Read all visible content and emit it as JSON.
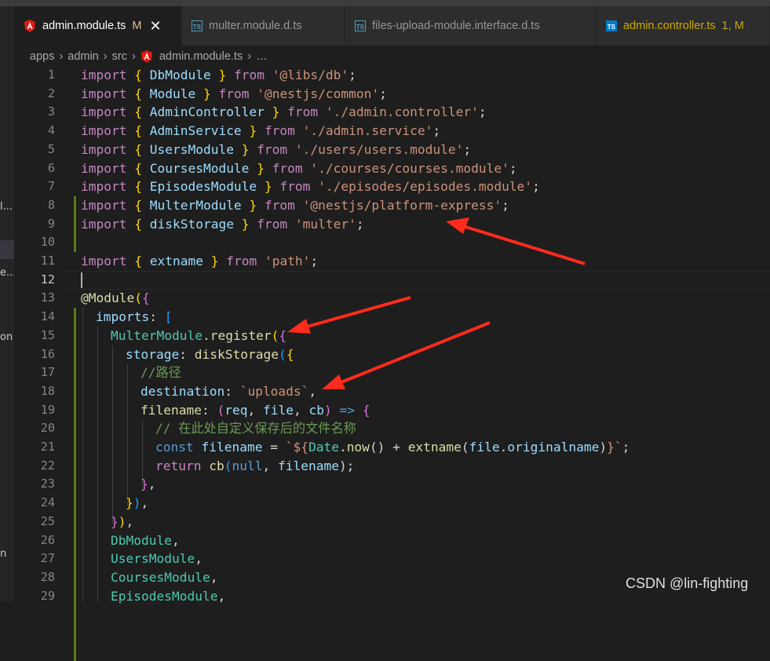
{
  "tabs": [
    {
      "label": "admin.module.ts",
      "modified": "M",
      "close": "✕",
      "icon": "angular-icon",
      "active": true
    },
    {
      "label": "multer.module.d.ts",
      "icon": "ts-icon"
    },
    {
      "label": "files-upload-module.interface.d.ts",
      "icon": "ts-icon"
    },
    {
      "label": "admin.controller.ts",
      "modified": "1, M",
      "icon": "ts-icon",
      "warn": true
    }
  ],
  "ts_icon_text": "TS",
  "breadcrumb": [
    "apps",
    "admin",
    "src",
    "admin.module.ts",
    "…"
  ],
  "activity_fragments": [
    "l...",
    "e...",
    "on",
    "n"
  ],
  "line_numbers": [
    "1",
    "2",
    "3",
    "4",
    "5",
    "6",
    "7",
    "8",
    "9",
    "10",
    "11",
    "12",
    "13",
    "14",
    "15",
    "16",
    "17",
    "18",
    "19",
    "20",
    "21",
    "22",
    "23",
    "24",
    "25",
    "26",
    "27",
    "28",
    "29"
  ],
  "current_line": "12",
  "code": {
    "l1": [
      "import",
      "{",
      "DbModule",
      "}",
      "from",
      "'@libs/db'",
      ";"
    ],
    "l2": [
      "import",
      "{",
      "Module",
      "}",
      "from",
      "'@nestjs/common'",
      ";"
    ],
    "l3": [
      "import",
      "{",
      "AdminController",
      "}",
      "from",
      "'./admin.controller'",
      ";"
    ],
    "l4": [
      "import",
      "{",
      "AdminService",
      "}",
      "from",
      "'./admin.service'",
      ";"
    ],
    "l5": [
      "import",
      "{",
      "UsersModule",
      "}",
      "from",
      "'./users/users.module'",
      ";"
    ],
    "l6": [
      "import",
      "{",
      "CoursesModule",
      "}",
      "from",
      "'./courses/courses.module'",
      ";"
    ],
    "l7": [
      "import",
      "{",
      "EpisodesModule",
      "}",
      "from",
      "'./episodes/episodes.module'",
      ";"
    ],
    "l8": [
      "import",
      "{",
      "MulterModule",
      "}",
      "from",
      "'@nestjs/platform-express'",
      ";"
    ],
    "l9": [
      "import",
      "{",
      "diskStorage",
      "}",
      "from",
      "'multer'",
      ";"
    ],
    "l11": [
      "import",
      "{",
      "extname",
      "}",
      "from",
      "'path'",
      ";"
    ],
    "l13": [
      "@",
      "Module",
      "(",
      "{"
    ],
    "l14": [
      "imports",
      ":",
      "["
    ],
    "l15": [
      "MulterModule",
      ".",
      "register",
      "(",
      "{"
    ],
    "l16": [
      "storage",
      ":",
      "diskStorage",
      "(",
      "{"
    ],
    "l17": "//路径",
    "l18": [
      "destination",
      ":",
      "`uploads`",
      ","
    ],
    "l19": [
      "filename",
      ":",
      "(",
      "req",
      ",",
      "file",
      ",",
      "cb",
      ")",
      "=>",
      "{"
    ],
    "l20": "// 在此处自定义保存后的文件名称",
    "l21": [
      "const",
      "filename",
      "=",
      "`${",
      "Date",
      ".",
      "now",
      "()",
      " + ",
      "extname",
      "(",
      "file",
      ".",
      "originalname",
      ")",
      "}`",
      ";"
    ],
    "l22": [
      "return",
      "cb",
      "(",
      "null",
      ",",
      "filename",
      ");"
    ],
    "l23": [
      "}",
      ","
    ],
    "l24": [
      "}",
      ")",
      ","
    ],
    "l25": [
      "}",
      ")",
      ","
    ],
    "l26": [
      "DbModule",
      ","
    ],
    "l27": [
      "UsersModule",
      ","
    ],
    "l28": [
      "CoursesModule",
      ","
    ],
    "l29": [
      "EpisodesModule",
      ","
    ]
  },
  "colors": {
    "arrow": "#ff2b1c",
    "added_line_bar": "#587c0c"
  },
  "watermark": "CSDN @lin-fighting"
}
